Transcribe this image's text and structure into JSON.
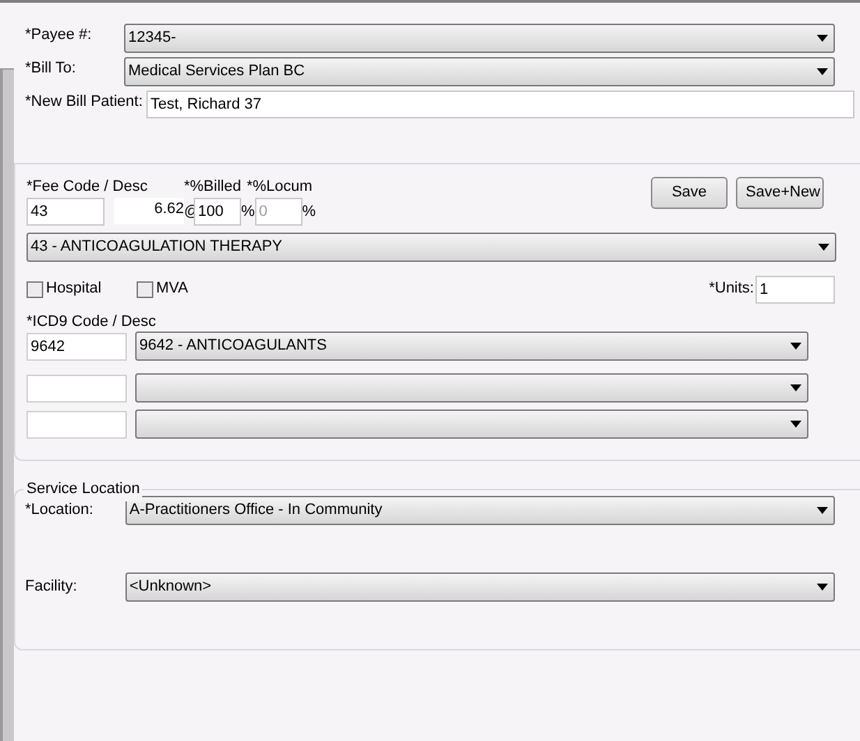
{
  "payee": {
    "label": "*Payee #:",
    "value": "12345-"
  },
  "bill_to": {
    "label": "*Bill To:",
    "value": "Medical Services Plan BC"
  },
  "new_bill_patient": {
    "label": "*New Bill Patient:",
    "value": "Test, Richard 37"
  },
  "fee": {
    "label": "*Fee Code / Desc",
    "billed_label": "*%Billed",
    "locum_label": "*%Locum",
    "code": "43",
    "amount": "6.62",
    "at_sign": "@",
    "billed": "100",
    "billed_unit": "%",
    "locum": "0",
    "locum_disabled": true,
    "locum_unit": "%",
    "description": "43 - ANTICOAGULATION THERAPY"
  },
  "buttons": [
    "Save",
    "Save+New"
  ],
  "checkboxes": [
    {
      "label": "Hospital",
      "checked": false
    },
    {
      "label": "MVA",
      "checked": false
    }
  ],
  "units": {
    "label": "*Units:",
    "value": "1"
  },
  "icd9": {
    "label": "*ICD9 Code / Desc",
    "rows": [
      {
        "code": "9642",
        "description": "9642 - ANTICOAGULANTS"
      },
      {},
      {}
    ]
  },
  "service_location": {
    "title": "Service Location",
    "location": {
      "label": "*Location:",
      "value": "A-Practitioners Office - In Community"
    },
    "facility": {
      "label": "Facility:",
      "value": "<Unknown>"
    }
  }
}
